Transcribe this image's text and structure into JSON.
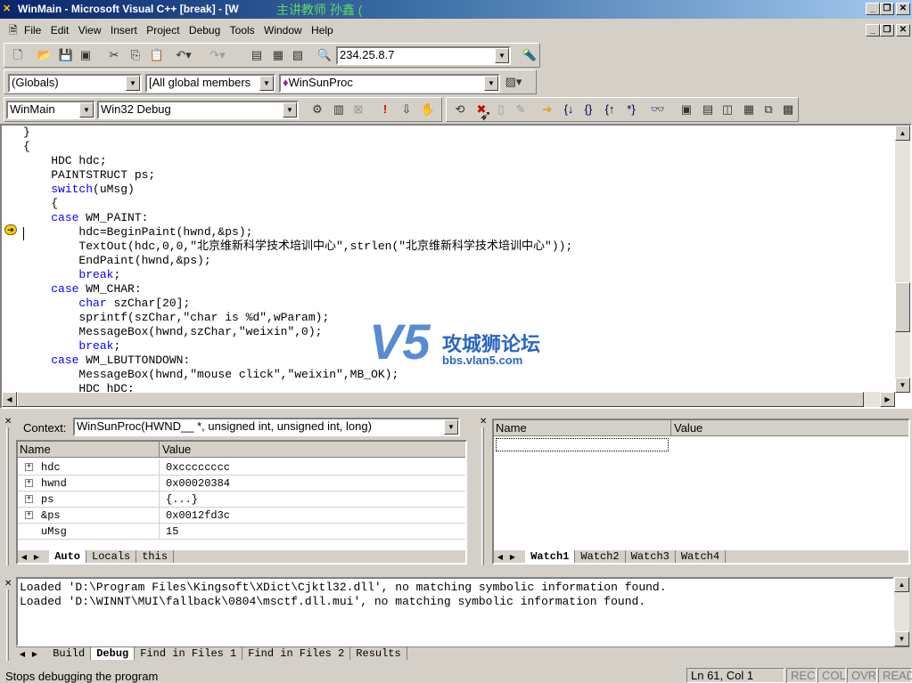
{
  "window": {
    "title": "WinMain - Microsoft Visual C++ [break] - [W",
    "overlay_text": "主讲教师  孙鑫 ("
  },
  "menu": [
    "File",
    "Edit",
    "View",
    "Insert",
    "Project",
    "Debug",
    "Tools",
    "Window",
    "Help"
  ],
  "toolbar": {
    "find_combo": "234.25.8.7",
    "scope_combo": "(Globals)",
    "members_combo": "[All global members",
    "function_combo": "WinSunProc",
    "project_combo": "WinMain",
    "config_combo": "Win32 Debug"
  },
  "editor": {
    "lines": [
      [
        {
          "t": "}"
        }
      ],
      [
        {
          "t": "{"
        }
      ],
      [
        {
          "t": "    HDC hdc;"
        }
      ],
      [
        {
          "t": "    PAINTSTRUCT ps;"
        }
      ],
      [
        {
          "t": "    "
        },
        {
          "t": "switch",
          "k": 1
        },
        {
          "t": "(uMsg)"
        }
      ],
      [
        {
          "t": "    {"
        }
      ],
      [
        {
          "t": "    "
        },
        {
          "t": "case",
          "k": 1
        },
        {
          "t": " WM_PAINT:"
        }
      ],
      [
        {
          "t": "        hdc=BeginPaint(hwnd,&ps);"
        }
      ],
      [
        {
          "t": "        TextOut(hdc,0,0,\"北京维新科学技术培训中心\",strlen(\"北京维新科学技术培训中心\"));"
        }
      ],
      [
        {
          "t": "        EndPaint(hwnd,&ps);"
        }
      ],
      [
        {
          "t": "        "
        },
        {
          "t": "break",
          "k": 1
        },
        {
          "t": ";"
        }
      ],
      [
        {
          "t": "    "
        },
        {
          "t": "case",
          "k": 1
        },
        {
          "t": " WM_CHAR:"
        }
      ],
      [
        {
          "t": "        "
        },
        {
          "t": "char",
          "k": 1
        },
        {
          "t": " szChar[20];"
        }
      ],
      [
        {
          "t": "        sprintf(szChar,\"char is %d\",wParam);"
        }
      ],
      [
        {
          "t": "        MessageBox(hwnd,szChar,\"weixin\",0);"
        }
      ],
      [
        {
          "t": "        "
        },
        {
          "t": "break",
          "k": 1
        },
        {
          "t": ";"
        }
      ],
      [
        {
          "t": "    "
        },
        {
          "t": "case",
          "k": 1
        },
        {
          "t": " WM_LBUTTONDOWN:"
        }
      ],
      [
        {
          "t": "        MessageBox(hwnd,\"mouse click\",\"weixin\",MB_OK);"
        }
      ],
      [
        {
          "t": "        HDC hDC;"
        }
      ]
    ],
    "logo_main": "V5",
    "logo_cn": "攻城狮论坛",
    "logo_url": "bbs.vlan5.com"
  },
  "variables": {
    "context_label": "Context:",
    "context_value": "WinSunProc(HWND__ *, unsigned int, unsigned int, long)",
    "col_name": "Name",
    "col_value": "Value",
    "rows": [
      {
        "name": "hdc",
        "value": "0xcccccccc",
        "expand": "+"
      },
      {
        "name": "hwnd",
        "value": "0x00020384",
        "expand": "+"
      },
      {
        "name": "ps",
        "value": "{...}",
        "expand": "+"
      },
      {
        "name": "&ps",
        "value": "0x0012fd3c",
        "expand": "+"
      },
      {
        "name": "uMsg",
        "value": "15",
        "expand": ""
      }
    ],
    "tabs": [
      "Auto",
      "Locals",
      "this"
    ]
  },
  "watch": {
    "col_name": "Name",
    "col_value": "Value",
    "tabs": [
      "Watch1",
      "Watch2",
      "Watch3",
      "Watch4"
    ]
  },
  "output": {
    "lines": [
      "Loaded 'D:\\Program Files\\Kingsoft\\XDict\\Cjktl32.dll', no matching symbolic information found.",
      "Loaded 'D:\\WINNT\\MUI\\fallback\\0804\\msctf.dll.mui', no matching symbolic information found."
    ],
    "tabs": [
      "Build",
      "Debug",
      "Find in Files 1",
      "Find in Files 2",
      "Results"
    ]
  },
  "status": {
    "message": "Stops debugging the program",
    "position": "Ln 61, Col 1",
    "rec": "REC",
    "col": "COL",
    "ovr": "OVR",
    "read": "READ"
  }
}
